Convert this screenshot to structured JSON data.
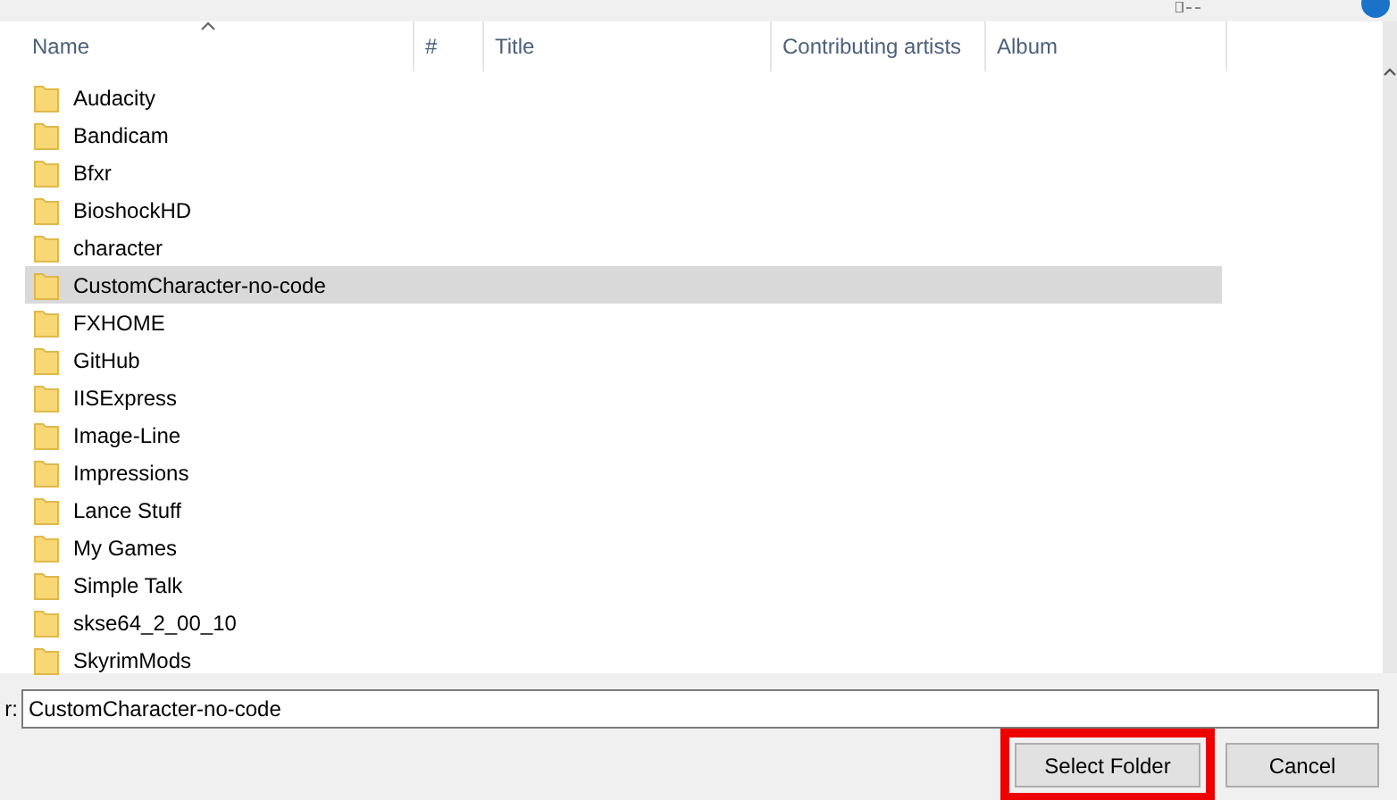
{
  "columns": [
    {
      "label": "Name",
      "sorted": true
    },
    {
      "label": "#",
      "sorted": false
    },
    {
      "label": "Title",
      "sorted": false
    },
    {
      "label": "Contributing artists",
      "sorted": false
    },
    {
      "label": "Album",
      "sorted": false
    }
  ],
  "rows": [
    {
      "name": "Audacity",
      "selected": false
    },
    {
      "name": "Bandicam",
      "selected": false
    },
    {
      "name": "Bfxr",
      "selected": false
    },
    {
      "name": "BioshockHD",
      "selected": false
    },
    {
      "name": "character",
      "selected": false
    },
    {
      "name": "CustomCharacter-no-code",
      "selected": true
    },
    {
      "name": "FXHOME",
      "selected": false
    },
    {
      "name": "GitHub",
      "selected": false
    },
    {
      "name": "IISExpress",
      "selected": false
    },
    {
      "name": "Image-Line",
      "selected": false
    },
    {
      "name": "Impressions",
      "selected": false
    },
    {
      "name": "Lance Stuff",
      "selected": false
    },
    {
      "name": "My Games",
      "selected": false
    },
    {
      "name": "Simple Talk",
      "selected": false
    },
    {
      "name": "skse64_2_00_10",
      "selected": false
    },
    {
      "name": "SkyrimMods",
      "selected": false
    }
  ],
  "folder_field": {
    "label": "r:",
    "value": "CustomCharacter-no-code"
  },
  "buttons": [
    {
      "label": "Select Folder",
      "highlighted": true
    },
    {
      "label": "Cancel",
      "highlighted": false
    }
  ]
}
